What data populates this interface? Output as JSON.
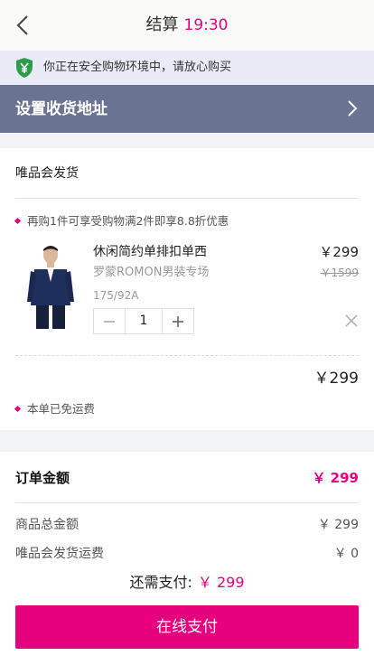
{
  "header": {
    "title": "结算",
    "time": "19:30"
  },
  "safety": {
    "text": "你正在安全购物环境中，请放心购买"
  },
  "address": {
    "label": "设置收货地址"
  },
  "shipment": {
    "shipper": "唯品会发货",
    "promo": "再购1件可享受购物满2件即享8.8折优惠",
    "product": {
      "name": "休闲简约单排扣单西",
      "store": "罗蒙ROMON男装专场",
      "spec": "175/92A",
      "price": "￥299",
      "original_price": "￥1599",
      "quantity": "1"
    },
    "subtotal": "￥299",
    "free_shipping": "本单已免运费"
  },
  "summary": {
    "order_label": "订单金额",
    "order_value": "￥ 299",
    "goods_total_label": "商品总金额",
    "goods_total_value": "￥ 299",
    "shipping_label": "唯品会发货运费",
    "shipping_value": "￥ 0",
    "due_label": "还需支付:",
    "due_value": "￥ 299",
    "pay_button": "在线支付"
  },
  "colors": {
    "accent": "#e6007e",
    "address_bar": "#6b7393",
    "safety_bg": "#e9ecf7",
    "shield": "#2e9d4a"
  }
}
